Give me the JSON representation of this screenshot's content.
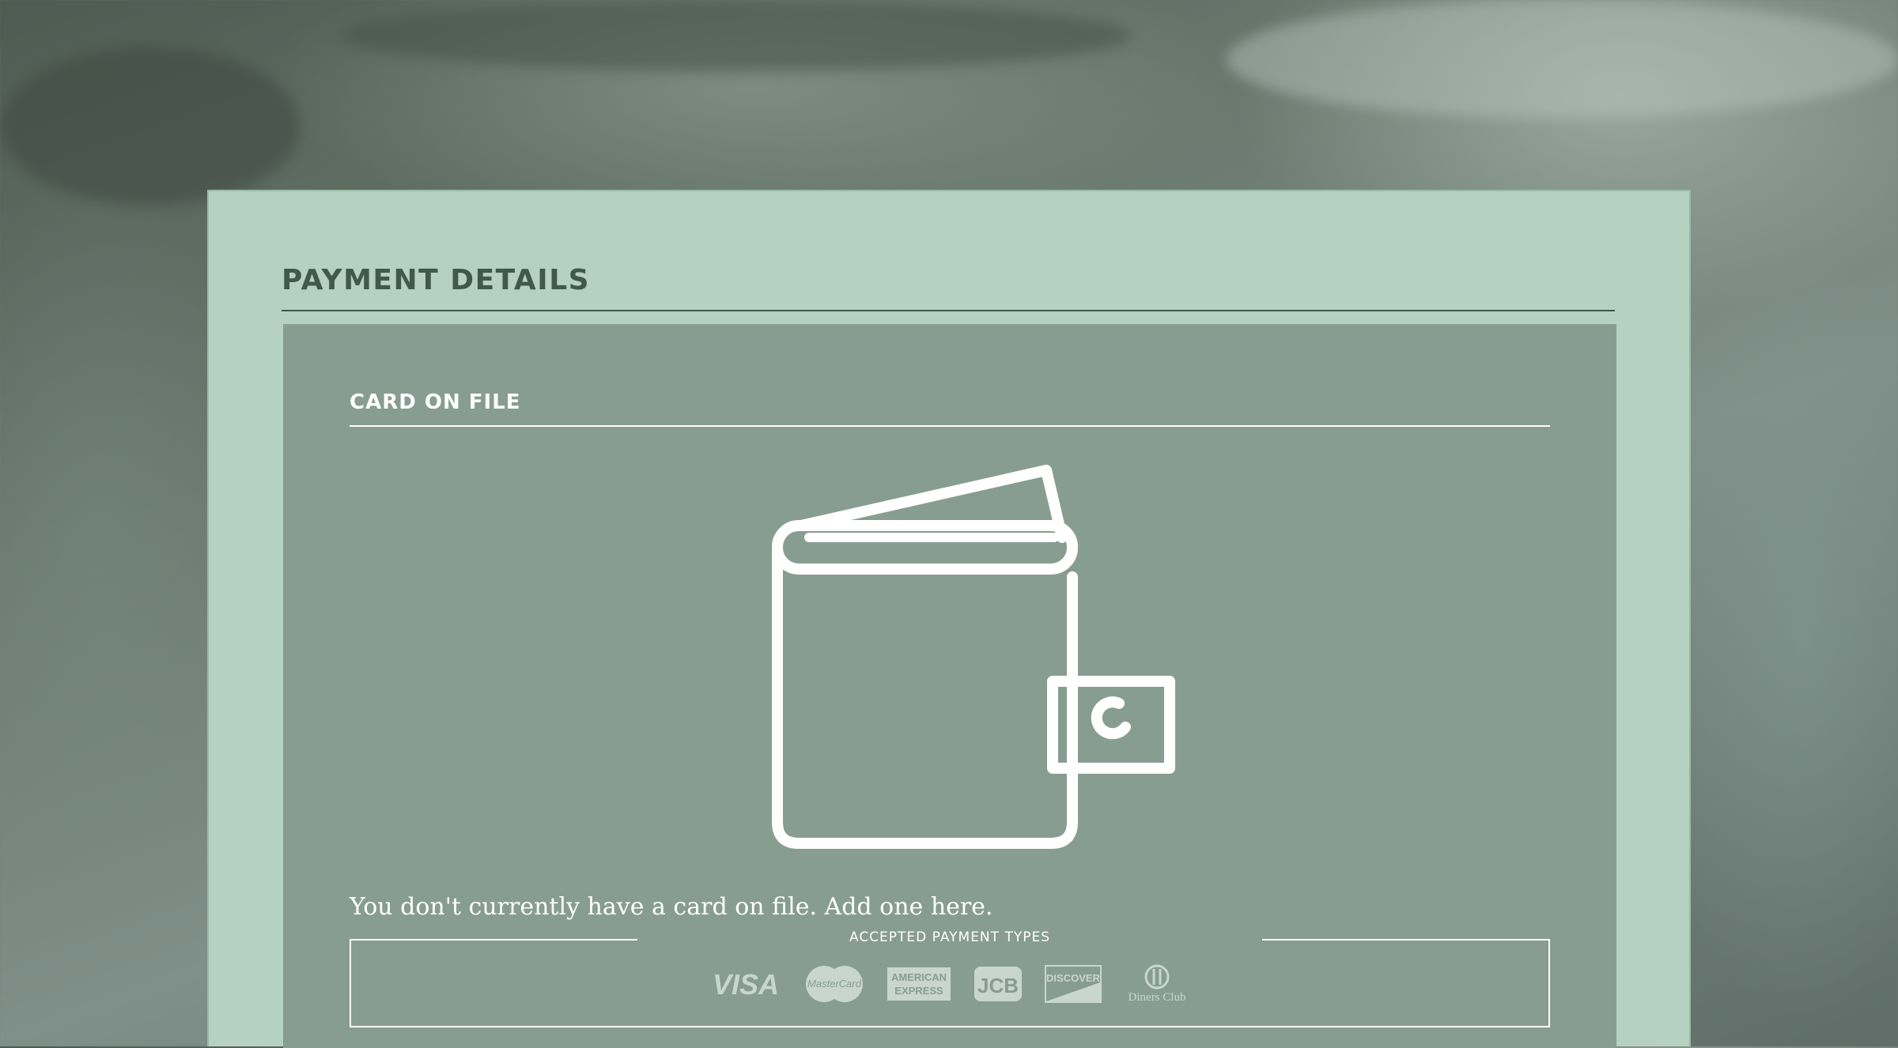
{
  "page": {
    "title": "PAYMENT DETAILS"
  },
  "card_section": {
    "heading": "CARD ON FILE",
    "empty_icon": "wallet-icon",
    "message": "You don't currently have a card on file. Add one here."
  },
  "payment_types": {
    "label": "ACCEPTED PAYMENT TYPES",
    "logos": [
      {
        "name": "visa",
        "text": "VISA"
      },
      {
        "name": "mastercard",
        "text": "MasterCard"
      },
      {
        "name": "american-express",
        "text": "AMERICAN EXPRESS"
      },
      {
        "name": "jcb",
        "text": "JCB"
      },
      {
        "name": "discover",
        "text": "DISCOVER"
      },
      {
        "name": "diners-club",
        "text": "Diners Club"
      }
    ]
  },
  "colors": {
    "panel": "#b5d1c2",
    "card": "#889d91",
    "heading": "#3f5a48",
    "logo": "#c8d6ce"
  }
}
